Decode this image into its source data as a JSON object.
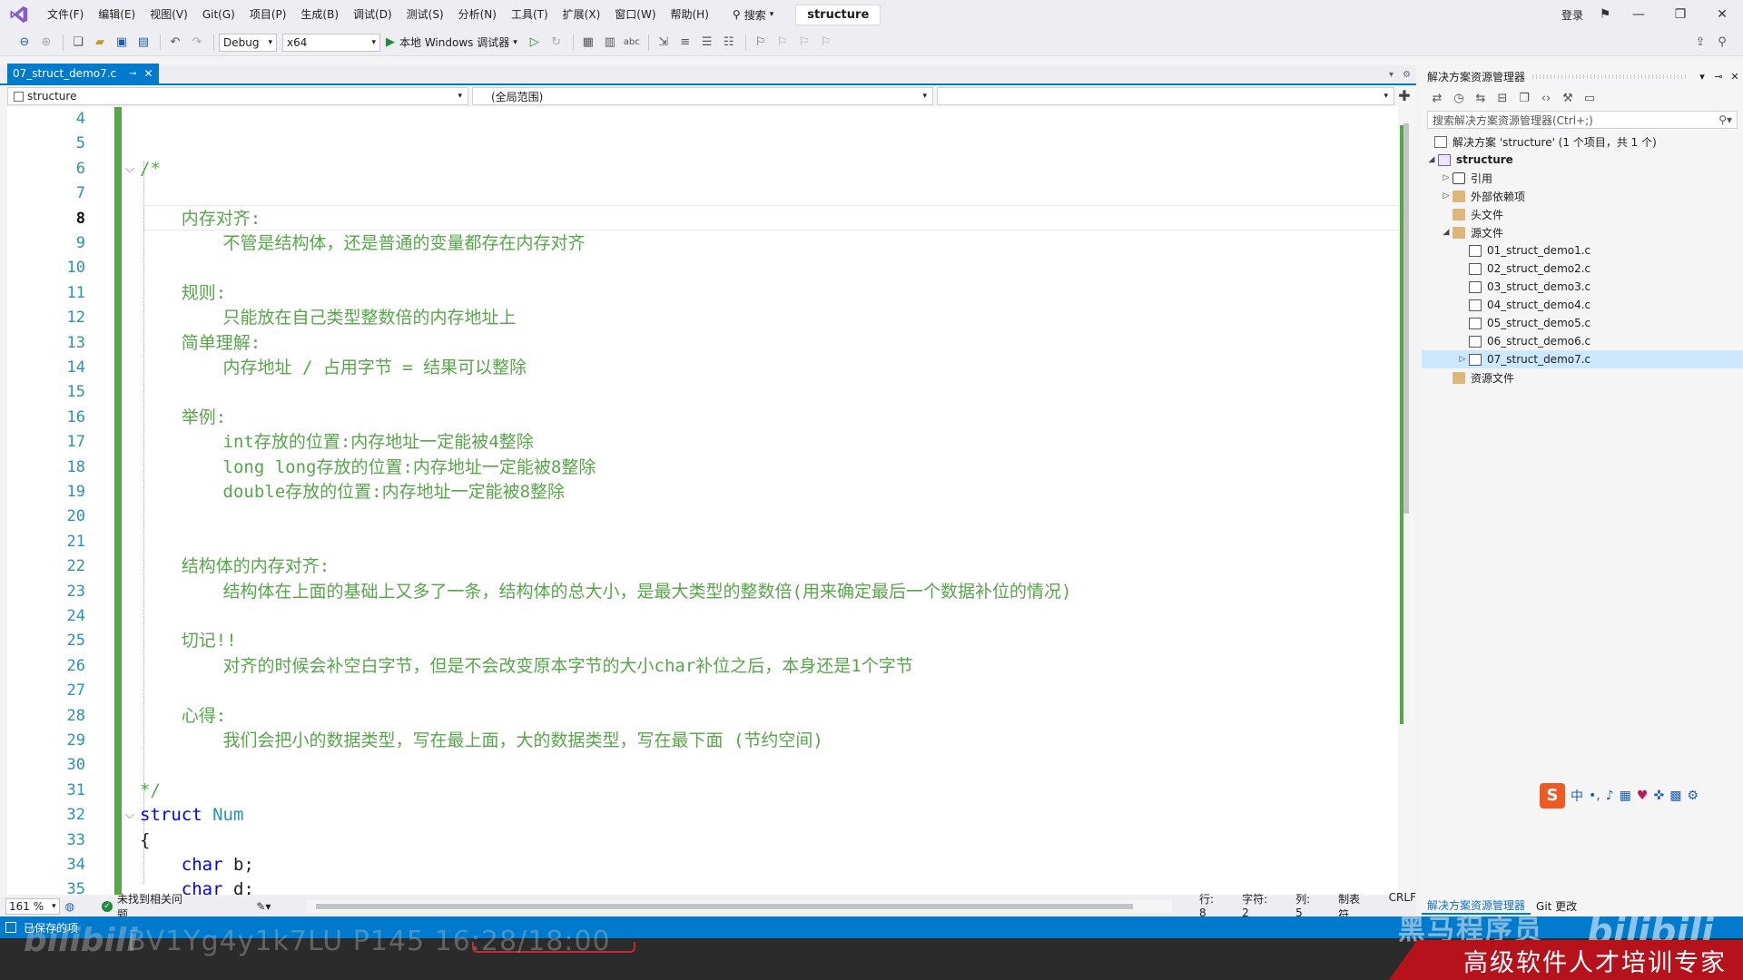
{
  "menubar": {
    "items": [
      "文件(F)",
      "编辑(E)",
      "视图(V)",
      "Git(G)",
      "项目(P)",
      "生成(B)",
      "调试(D)",
      "测试(S)",
      "分析(N)",
      "工具(T)",
      "扩展(X)",
      "窗口(W)",
      "帮助(H)"
    ],
    "search_label": "搜索",
    "solution_name": "structure",
    "login": "登录"
  },
  "toolbar": {
    "config": "Debug",
    "platform": "x64",
    "run_label": "本地 Windows 调试器"
  },
  "tabs": {
    "active": "07_struct_demo7.c"
  },
  "navbar": {
    "project": "structure",
    "scope": "(全局范围)",
    "member": ""
  },
  "editor": {
    "lines": [
      {
        "n": "4",
        "text": ""
      },
      {
        "n": "5",
        "text": ""
      },
      {
        "n": "6",
        "text": "/*"
      },
      {
        "n": "7",
        "text": ""
      },
      {
        "n": "8",
        "text": "    内存对齐:"
      },
      {
        "n": "9",
        "text": "        不管是结构体，还是普通的变量都存在内存对齐"
      },
      {
        "n": "10",
        "text": ""
      },
      {
        "n": "11",
        "text": "    规则:"
      },
      {
        "n": "12",
        "text": "        只能放在自己类型整数倍的内存地址上"
      },
      {
        "n": "13",
        "text": "    简单理解:"
      },
      {
        "n": "14",
        "text": "        内存地址 / 占用字节 = 结果可以整除"
      },
      {
        "n": "15",
        "text": ""
      },
      {
        "n": "16",
        "text": "    举例:"
      },
      {
        "n": "17",
        "text": "        int存放的位置:内存地址一定能被4整除"
      },
      {
        "n": "18",
        "text": "        long long存放的位置:内存地址一定能被8整除"
      },
      {
        "n": "19",
        "text": "        double存放的位置:内存地址一定能被8整除"
      },
      {
        "n": "20",
        "text": ""
      },
      {
        "n": "21",
        "text": ""
      },
      {
        "n": "22",
        "text": "    结构体的内存对齐:"
      },
      {
        "n": "23",
        "text": "        结构体在上面的基础上又多了一条，结构体的总大小，是最大类型的整数倍(用来确定最后一个数据补位的情况)"
      },
      {
        "n": "24",
        "text": ""
      },
      {
        "n": "25",
        "text": "    切记!!"
      },
      {
        "n": "26",
        "text": "        对齐的时候会补空白字节，但是不会改变原本字节的大小char补位之后，本身还是1个字节"
      },
      {
        "n": "27",
        "text": ""
      },
      {
        "n": "28",
        "text": "    心得:"
      },
      {
        "n": "29",
        "text": "        我们会把小的数据类型，写在最上面，大的数据类型，写在最下面 (节约空间)"
      },
      {
        "n": "30",
        "text": ""
      },
      {
        "n": "31",
        "text": "*/"
      },
      {
        "n": "32",
        "kw": "struct",
        "ty": "Num"
      },
      {
        "n": "33",
        "text": "{"
      },
      {
        "n": "34",
        "text": "    char b;"
      },
      {
        "n": "35",
        "text": "    char d;"
      }
    ]
  },
  "edit_status": {
    "zoom": "161 %",
    "issues": "未找到相关问题",
    "row": "行: 8",
    "char": "字符: 2",
    "col": "列: 5",
    "tabs": "制表符",
    "eol": "CRLF"
  },
  "solution_explorer": {
    "title": "解决方案资源管理器",
    "search_placeholder": "搜索解决方案资源管理器(Ctrl+;)",
    "solution": "解决方案 'structure' (1 个项目，共 1 个)",
    "project": "structure",
    "nodes": {
      "refs": "引用",
      "external": "外部依赖项",
      "headers": "头文件",
      "sources": "源文件",
      "resources": "资源文件"
    },
    "files": [
      "01_struct_demo1.c",
      "02_struct_demo2.c",
      "03_struct_demo3.c",
      "04_struct_demo4.c",
      "05_struct_demo5.c",
      "06_struct_demo6.c",
      "07_struct_demo7.c"
    ],
    "bottom_tabs": [
      "解决方案资源管理器",
      "Git 更改"
    ]
  },
  "ime": {
    "logo": "S",
    "mode": "中"
  },
  "statusbar": {
    "text": "已保存的项"
  },
  "overlay": {
    "video_id": "BV1Yg4y1k7LU P145 16:28/18:00",
    "brand": "黑马程序员",
    "slogan": "高级软件人才培训专家",
    "bili": "bilibili"
  }
}
